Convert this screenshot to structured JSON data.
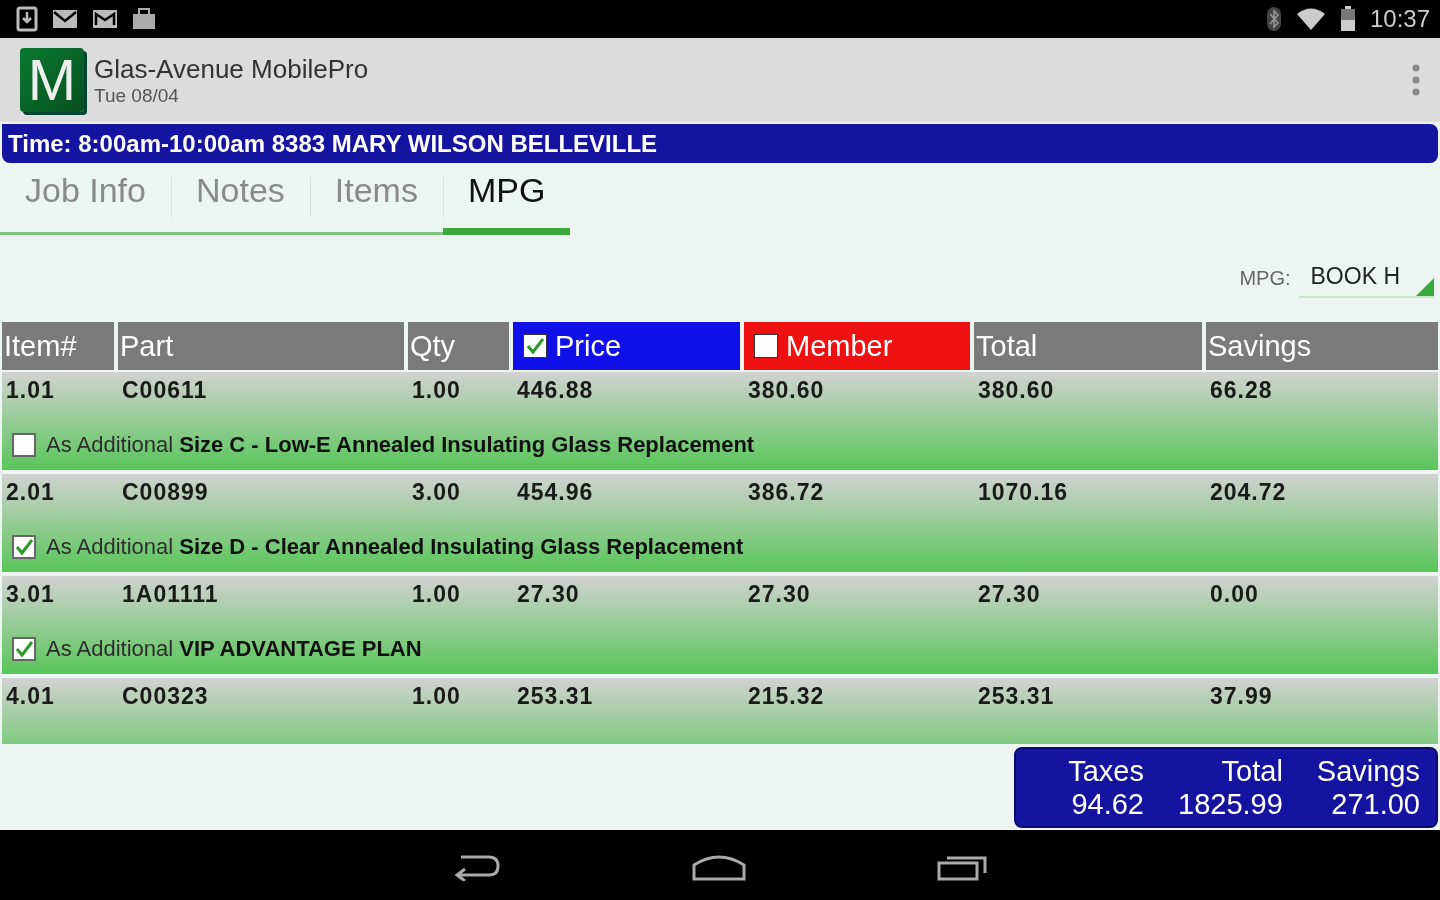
{
  "status_bar": {
    "time": "10:37"
  },
  "app_bar": {
    "logo": "M",
    "title": "Glas-Avenue MobilePro",
    "subtitle": "Tue 08/04"
  },
  "job_banner": "Time: 8:00am-10:00am 8383 MARY WILSON  BELLEVILLE",
  "tabs": [
    {
      "label": "Job Info",
      "selected": false
    },
    {
      "label": "Notes",
      "selected": false
    },
    {
      "label": "Items",
      "selected": false
    },
    {
      "label": "MPG",
      "selected": true
    }
  ],
  "mpg_selector": {
    "label": "MPG:",
    "value": "BOOK H"
  },
  "table": {
    "columns": [
      {
        "label": "Item#"
      },
      {
        "label": "Part"
      },
      {
        "label": "Qty"
      },
      {
        "label": "Price",
        "kind": "checkbox",
        "checked": true,
        "color": "#1010e8"
      },
      {
        "label": "Member",
        "kind": "checkbox",
        "checked": false,
        "color": "#ee1111"
      },
      {
        "label": "Total"
      },
      {
        "label": "Savings"
      }
    ],
    "rows": [
      {
        "cells": [
          "1.01",
          "C00611",
          "1.00",
          "446.88",
          "380.60",
          "380.60",
          "66.28"
        ],
        "additional_label": "As Additional",
        "additional": false,
        "description": "Size C - Low-E Annealed Insulating Glass Replacement"
      },
      {
        "cells": [
          "2.01",
          "C00899",
          "3.00",
          "454.96",
          "386.72",
          "1070.16",
          "204.72"
        ],
        "additional_label": "As Additional",
        "additional": true,
        "description": "Size D - Clear Annealed Insulating Glass Replacement"
      },
      {
        "cells": [
          "3.01",
          "1A01111",
          "1.00",
          "27.30",
          "27.30",
          "27.30",
          "0.00"
        ],
        "additional_label": "As Additional",
        "additional": true,
        "description": "VIP ADVANTAGE PLAN"
      },
      {
        "cells": [
          "4.01",
          "C00323",
          "1.00",
          "253.31",
          "215.32",
          "253.31",
          "37.99"
        ]
      }
    ]
  },
  "totals": [
    {
      "label": "Taxes",
      "value": "94.62"
    },
    {
      "label": "Total",
      "value": "1825.99"
    },
    {
      "label": "Savings",
      "value": "271.00"
    }
  ]
}
